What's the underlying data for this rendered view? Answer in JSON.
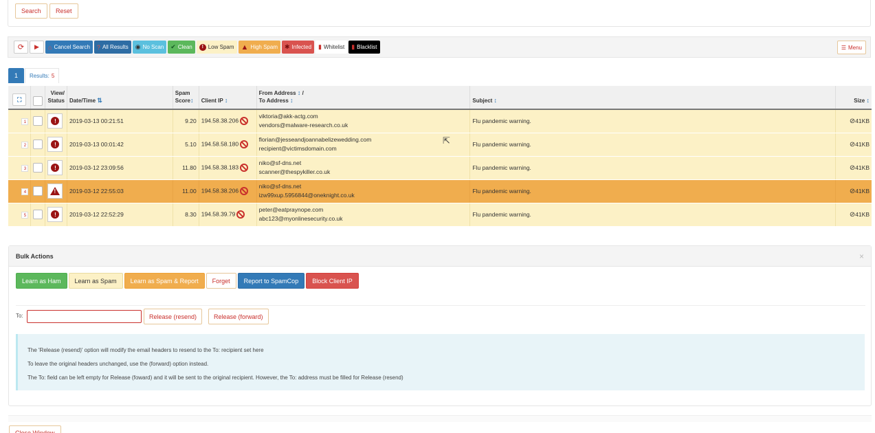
{
  "search_panel": {
    "search_label": "Search",
    "reset_label": "Reset"
  },
  "toolbar": {
    "refresh_icon": "refresh-icon",
    "play_icon": "play-icon",
    "cancel_search": "Cancel Search",
    "all_results": "All Results",
    "no_scan": "No Scan",
    "clean": "Clean",
    "low_spam": "Low Spam",
    "high_spam": "High Spam",
    "infected": "Infected",
    "whitelist": "Whitelist",
    "blacklist": "Blacklist",
    "menu": "Menu",
    "colors": {
      "primary": "#337ab7",
      "info": "#5bc0de",
      "success": "#5cb85c",
      "warning": "#f0ad4e",
      "danger": "#d9534f",
      "dark": "#000000"
    }
  },
  "tabs": {
    "page": "1",
    "results_label": "Results:",
    "results_count": "5"
  },
  "table": {
    "headers": {
      "view": "View/",
      "status": "Status",
      "datetime": "Date/Time",
      "spam": "Spam",
      "score": "Score",
      "client_ip": "Client IP",
      "from": "From Address",
      "from_sep": "/",
      "to": "To Address",
      "subject": "Subject",
      "size": "Size"
    },
    "rows": [
      {
        "num": "1",
        "status": "high-spam",
        "datetime": "2019-03-13 00:21:51",
        "score": "9.20",
        "ip": "194.58.38.206",
        "from": "viktoria@akk-actg.com",
        "to": "vendors@malware-research.co.uk",
        "subject": "Flu pandemic warning.",
        "size": "41KB"
      },
      {
        "num": "2",
        "status": "high-spam",
        "datetime": "2019-03-13 00:01:42",
        "score": "5.10",
        "ip": "194.58.58.180",
        "from": "florian@jesseandjoannabelizewedding.com",
        "to": "recipient@victimsdomain.com",
        "subject": "Flu pandemic warning.",
        "size": "41KB"
      },
      {
        "num": "3",
        "status": "high-spam",
        "datetime": "2019-03-12 23:09:56",
        "score": "11.80",
        "ip": "194.58.38.183",
        "from": "niko@sf-dns.net",
        "to": "scanner@thespykiller.co.uk",
        "subject": "Flu pandemic warning.",
        "size": "41KB"
      },
      {
        "num": "4",
        "status": "infected",
        "datetime": "2019-03-12 22:55:03",
        "score": "11.00",
        "ip": "194.58.38.206",
        "from": "niko@sf-dns.net",
        "to": "izw99xup.5956844@oneknight.co.uk",
        "subject": "Flu pandemic warning.",
        "size": "41KB"
      },
      {
        "num": "5",
        "status": "high-spam",
        "datetime": "2019-03-12 22:52:29",
        "score": "8.30",
        "ip": "194.58.39.79",
        "from": "peter@eatpraynope.com",
        "to": "abc123@myonlinesecurity.co.uk",
        "subject": "Flu pandemic warning.",
        "size": "41KB"
      }
    ]
  },
  "bulk": {
    "title": "Bulk Actions",
    "close": "×",
    "learn_ham": "Learn as Ham",
    "learn_spam": "Learn as Spam",
    "learn_spam_report": "Learn as Spam & Report",
    "forget": "Forget",
    "report_spamcop": "Report to SpamCop",
    "block_ip": "Block Client IP",
    "to_label": "To:",
    "to_value": "",
    "release_resend": "Release (resend)",
    "release_forward": "Release (forward)",
    "info_lines": [
      "The 'Release (resend)' option will modify the email headers to resend to the To: recipient set here",
      "To leave the original headers unchanged, use the (forward) option instead.",
      "The To: field can be left empty for Release (foward) and it will be sent to the original recipient. However, the To: address must be filled for Release (resend)"
    ]
  },
  "footer": {
    "close_window": "Close Window"
  }
}
